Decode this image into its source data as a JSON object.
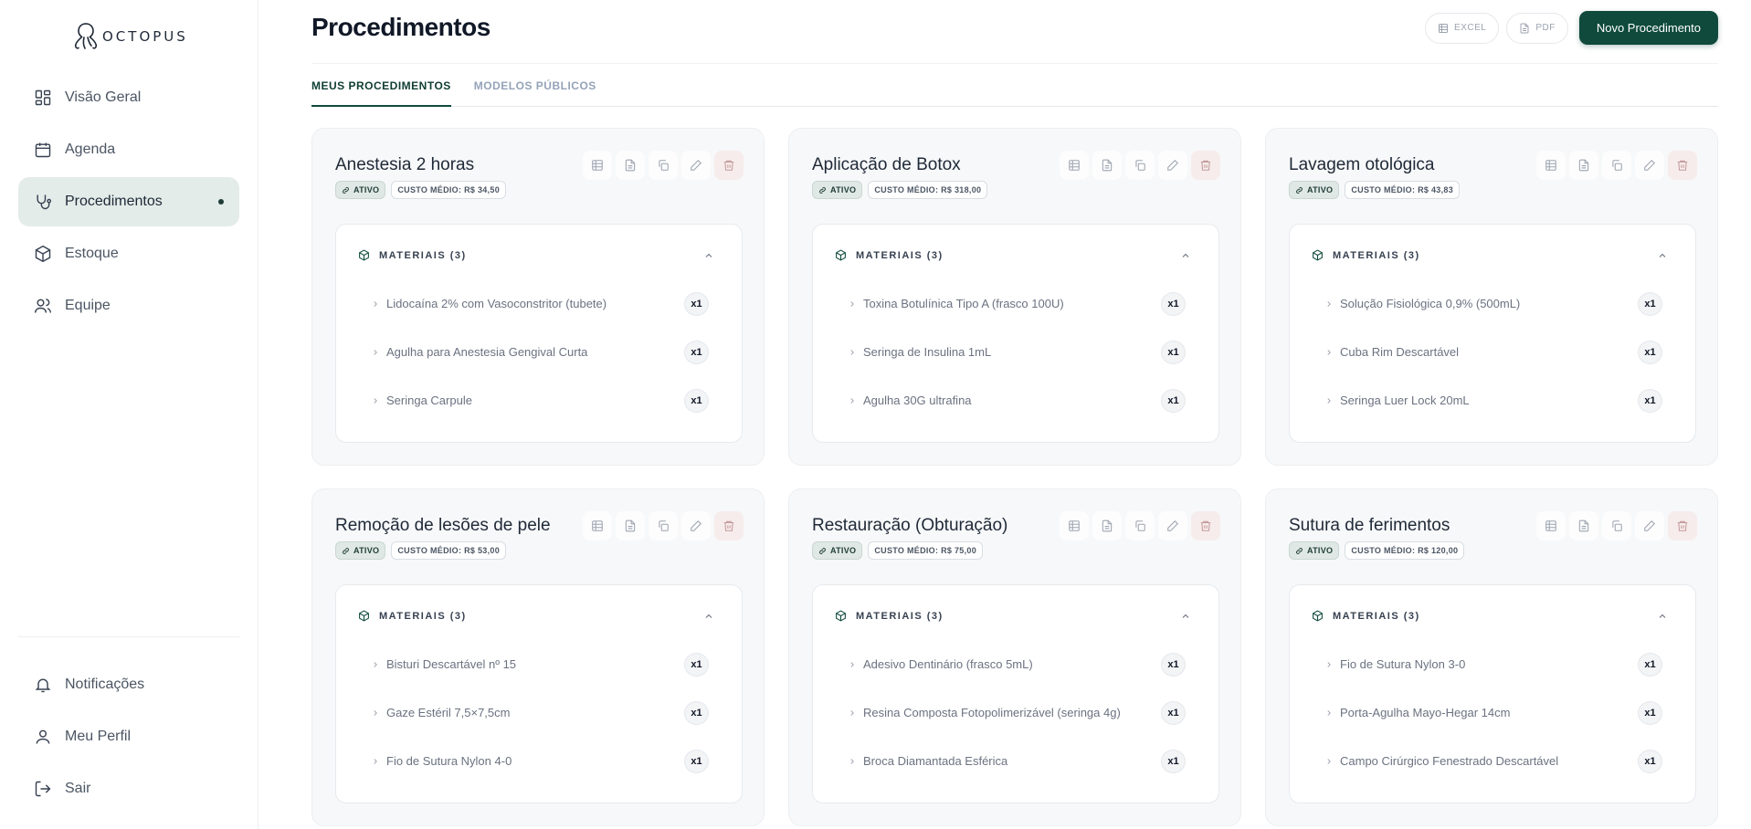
{
  "app": {
    "logo_text": "OCTOPUS"
  },
  "sidebar": {
    "items": [
      {
        "label": "Visão Geral",
        "icon": "grid-icon"
      },
      {
        "label": "Agenda",
        "icon": "calendar-icon"
      },
      {
        "label": "Procedimentos",
        "icon": "stethoscope-icon",
        "active": true
      },
      {
        "label": "Estoque",
        "icon": "box-icon"
      },
      {
        "label": "Equipe",
        "icon": "users-icon"
      }
    ],
    "bottom_items": [
      {
        "label": "Notificações",
        "icon": "bell-icon"
      },
      {
        "label": "Meu Perfil",
        "icon": "user-icon"
      },
      {
        "label": "Sair",
        "icon": "logout-icon"
      }
    ]
  },
  "header": {
    "title": "Procedimentos",
    "excel_label": "EXCEL",
    "pdf_label": "PDF",
    "new_label": "Novo Procedimento"
  },
  "tabs": [
    {
      "label": "MEUS PROCEDIMENTOS",
      "active": true
    },
    {
      "label": "MODELOS PÚBLICOS",
      "active": false
    }
  ],
  "cards": [
    {
      "title": "Anestesia 2 horas",
      "status": "ATIVO",
      "cost": "CUSTO MÉDIO: R$ 34,50",
      "materials_label": "MATERIAIS (3)",
      "materials": [
        {
          "name": "Lidocaína 2% com Vasoconstritor (tubete)",
          "qty": "x1"
        },
        {
          "name": "Agulha para Anestesia Gengival Curta",
          "qty": "x1"
        },
        {
          "name": "Seringa Carpule",
          "qty": "x1"
        }
      ]
    },
    {
      "title": "Aplicação de Botox",
      "status": "ATIVO",
      "cost": "CUSTO MÉDIO: R$ 318,00",
      "materials_label": "MATERIAIS (3)",
      "materials": [
        {
          "name": "Toxina Botulínica Tipo A (frasco 100U)",
          "qty": "x1"
        },
        {
          "name": "Seringa de Insulina 1mL",
          "qty": "x1"
        },
        {
          "name": "Agulha 30G ultrafina",
          "qty": "x1"
        }
      ]
    },
    {
      "title": "Lavagem otológica",
      "status": "ATIVO",
      "cost": "CUSTO MÉDIO: R$ 43,83",
      "materials_label": "MATERIAIS (3)",
      "materials": [
        {
          "name": "Solução Fisiológica 0,9% (500mL)",
          "qty": "x1"
        },
        {
          "name": "Cuba Rim Descartável",
          "qty": "x1"
        },
        {
          "name": "Seringa Luer Lock 20mL",
          "qty": "x1"
        }
      ]
    },
    {
      "title": "Remoção de lesões de pele",
      "status": "ATIVO",
      "cost": "CUSTO MÉDIO: R$ 53,00",
      "materials_label": "MATERIAIS (3)",
      "materials": [
        {
          "name": "Bisturi Descartável nº 15",
          "qty": "x1"
        },
        {
          "name": "Gaze Estéril 7,5×7,5cm",
          "qty": "x1"
        },
        {
          "name": "Fio de Sutura Nylon 4-0",
          "qty": "x1"
        }
      ]
    },
    {
      "title": "Restauração (Obturação)",
      "status": "ATIVO",
      "cost": "CUSTO MÉDIO: R$ 75,00",
      "materials_label": "MATERIAIS (3)",
      "materials": [
        {
          "name": "Adesivo Dentinário (frasco 5mL)",
          "qty": "x1"
        },
        {
          "name": "Resina Composta Fotopolimerizável (seringa 4g)",
          "qty": "x1"
        },
        {
          "name": "Broca Diamantada Esférica",
          "qty": "x1"
        }
      ]
    },
    {
      "title": "Sutura de ferimentos",
      "status": "ATIVO",
      "cost": "CUSTO MÉDIO: R$ 120,00",
      "materials_label": "MATERIAIS (3)",
      "materials": [
        {
          "name": "Fio de Sutura Nylon 3-0",
          "qty": "x1"
        },
        {
          "name": "Porta-Agulha Mayo-Hegar 14cm",
          "qty": "x1"
        },
        {
          "name": "Campo Cirúrgico Fenestrado Descartável",
          "qty": "x1"
        }
      ]
    }
  ]
}
